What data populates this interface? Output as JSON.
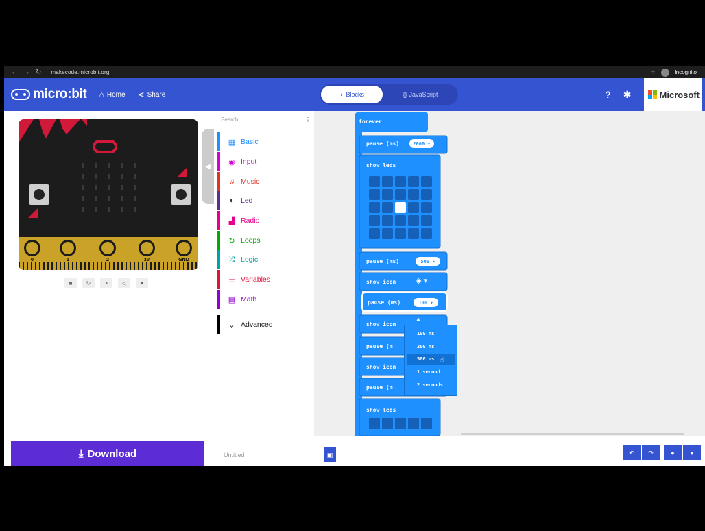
{
  "browser": {
    "url": "makecode.microbit.org",
    "profile_label": "Incognito"
  },
  "header": {
    "brand": "micro:bit",
    "home_label": "Home",
    "share_label": "Share",
    "tabs": [
      {
        "label": "Blocks"
      },
      {
        "label": "JavaScript"
      }
    ],
    "microsoft_label": "Microsoft"
  },
  "simulator": {
    "pins": [
      "0",
      "1",
      "2",
      "3V",
      "GND"
    ]
  },
  "toolbox": {
    "search_placeholder": "Search...",
    "categories": [
      {
        "label": "Basic",
        "color": "#1e90ff"
      },
      {
        "label": "Input",
        "color": "#d400d4"
      },
      {
        "label": "Music",
        "color": "#e63022"
      },
      {
        "label": "Led",
        "color": "#5c2d91"
      },
      {
        "label": "Radio",
        "color": "#e3008c"
      },
      {
        "label": "Loops",
        "color": "#00aa00"
      },
      {
        "label": "Logic",
        "color": "#00a4a6"
      },
      {
        "label": "Variables",
        "color": "#dc143c"
      },
      {
        "label": "Math",
        "color": "#9400d3"
      },
      {
        "label": "Advanced",
        "color": "#000000"
      }
    ]
  },
  "blocks": {
    "forever": "forever",
    "pause_1": {
      "label": "pause (ms)",
      "value": "2000"
    },
    "show_leds_1": "show leds",
    "pause_2": {
      "label": "pause (ms)",
      "value": "500"
    },
    "show_icon_1": "show icon",
    "pause_3": {
      "label": "pause (ms)",
      "value": "100"
    },
    "show_icon_2": "show icon",
    "pause_4": "pause (m",
    "show_icon_3": "show icon",
    "pause_5": "pause (m",
    "show_leds_2": "show leds"
  },
  "dropdown": {
    "options": [
      "100 ms",
      "200 ms",
      "500 ms",
      "1 second",
      "2 seconds"
    ],
    "selected": "500 ms"
  },
  "bottom": {
    "download_label": "Download",
    "project_name": "Untitled"
  },
  "colors": {
    "header": "#3454d1",
    "download": "#5c2dd5",
    "block_basic": "#1e90ff"
  }
}
